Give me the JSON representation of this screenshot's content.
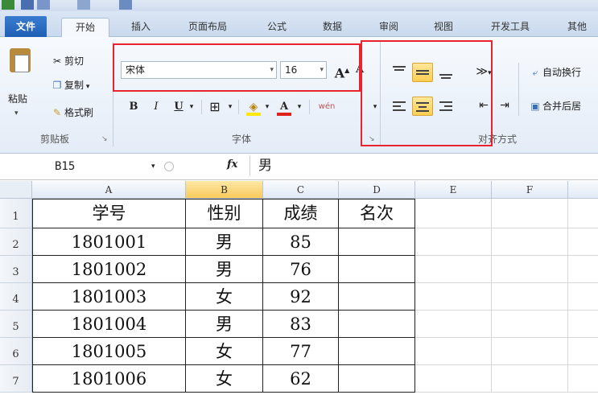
{
  "tabs": [
    "文件",
    "开始",
    "插入",
    "页面布局",
    "公式",
    "数据",
    "审阅",
    "视图",
    "开发工具",
    "其他"
  ],
  "clipboard": {
    "paste": "粘贴",
    "cut": "剪切",
    "copy": "复制",
    "format_painter": "格式刷",
    "group_label": "剪贴板"
  },
  "font": {
    "name": "宋体",
    "size": "16",
    "grow": "A",
    "shrink": "A",
    "bold": "B",
    "italic": "I",
    "underline": "U",
    "font_color": "A",
    "wen": "wén",
    "group_label": "字体"
  },
  "alignment": {
    "wrap_text": "自动换行",
    "merge_center": "合并后居",
    "group_label": "对齐方式"
  },
  "formula_bar": {
    "name_box": "B15",
    "fx": "fx",
    "value": "男"
  },
  "columns": [
    "A",
    "B",
    "C",
    "D",
    "E",
    "F"
  ],
  "rows": [
    "1",
    "2",
    "3",
    "4",
    "5",
    "6",
    "7"
  ],
  "table": [
    [
      "学号",
      "性别",
      "成绩",
      "名次"
    ],
    [
      "1801001",
      "男",
      "85",
      ""
    ],
    [
      "1801002",
      "男",
      "76",
      ""
    ],
    [
      "1801003",
      "女",
      "92",
      ""
    ],
    [
      "1801004",
      "男",
      "83",
      ""
    ],
    [
      "1801005",
      "女",
      "77",
      ""
    ],
    [
      "1801006",
      "女",
      "62",
      ""
    ]
  ],
  "colors": {
    "highlight_box": "#e8232f",
    "selected_column": "#f8c95a",
    "file_tab": "#2a6cc4"
  }
}
